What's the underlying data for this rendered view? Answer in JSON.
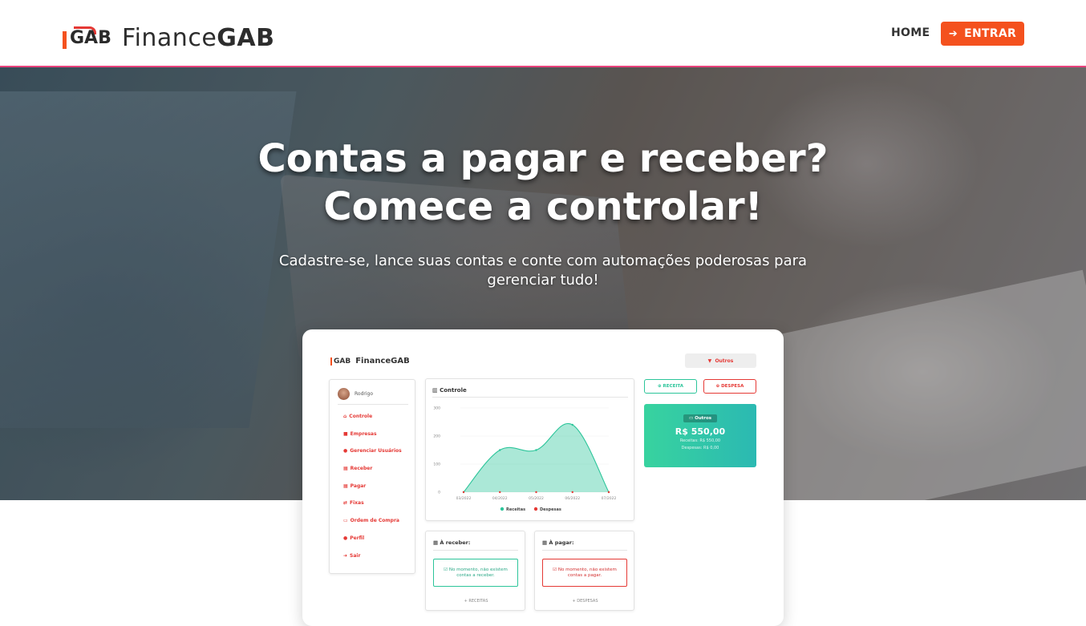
{
  "navbar": {
    "logo_mark": "GAB",
    "brand_light": "Finance",
    "brand_bold": "GAB",
    "home_label": "HOME",
    "enter_label": "ENTRAR"
  },
  "hero": {
    "title_line1": "Contas a pagar e receber?",
    "title_line2": "Comece a controlar!",
    "subtitle": "Cadastre-se, lance suas contas e conte com automações poderosas para gerenciar tudo!"
  },
  "preview": {
    "brand_mark": "GAB",
    "brand": "FinanceGAB",
    "filter_label": "Outros",
    "user_name": "Rodrigo",
    "menu": [
      {
        "icon": "home-icon",
        "glyph": "⌂",
        "label": "Controle"
      },
      {
        "icon": "briefcase-icon",
        "glyph": "■",
        "label": "Empresas"
      },
      {
        "icon": "user-icon",
        "glyph": "●",
        "label": "Gerenciar Usuários"
      },
      {
        "icon": "calendar-icon",
        "glyph": "▦",
        "label": "Receber"
      },
      {
        "icon": "calendar-icon",
        "glyph": "▦",
        "label": "Pagar"
      },
      {
        "icon": "exchange-icon",
        "glyph": "⇄",
        "label": "Fixas"
      },
      {
        "icon": "card-icon",
        "glyph": "▭",
        "label": "Ordem de Compra"
      },
      {
        "icon": "user-icon",
        "glyph": "●",
        "label": "Perfil"
      },
      {
        "icon": "sign-out-icon",
        "glyph": "➜",
        "label": "Sair"
      }
    ],
    "chart_title": "Controle",
    "btn_receita": "RECEITA",
    "btn_despesa": "DESPESA",
    "total_tag": "Outros",
    "total_amount": "R$ 550,00",
    "total_receitas": "Receitas: R$ 550,00",
    "total_despesas": "Despesas: R$ 0,00",
    "receber_title": "À receber:",
    "receber_alert": "No momento, não existem contas a receber.",
    "receber_link": "+ RECEITAS",
    "pagar_title": "À pagar:",
    "pagar_alert": "No momento, não existem contas a pagar.",
    "pagar_link": "+ DESPESAS",
    "colors": {
      "receitas": "#2cc59a",
      "despesas": "#e53935",
      "accent": "#f4511e"
    }
  },
  "chart_data": {
    "type": "area",
    "categories": [
      "03/2022",
      "04/2022",
      "05/2022",
      "06/2022",
      "07/2022"
    ],
    "series": [
      {
        "name": "Receitas",
        "values": [
          0,
          150,
          150,
          240,
          0
        ],
        "color": "#2cc59a"
      },
      {
        "name": "Despesas",
        "values": [
          0,
          0,
          0,
          0,
          0
        ],
        "color": "#e53935"
      }
    ],
    "y_ticks": [
      0,
      100,
      200,
      300
    ],
    "ylim": [
      0,
      300
    ],
    "legend": "bottom"
  }
}
